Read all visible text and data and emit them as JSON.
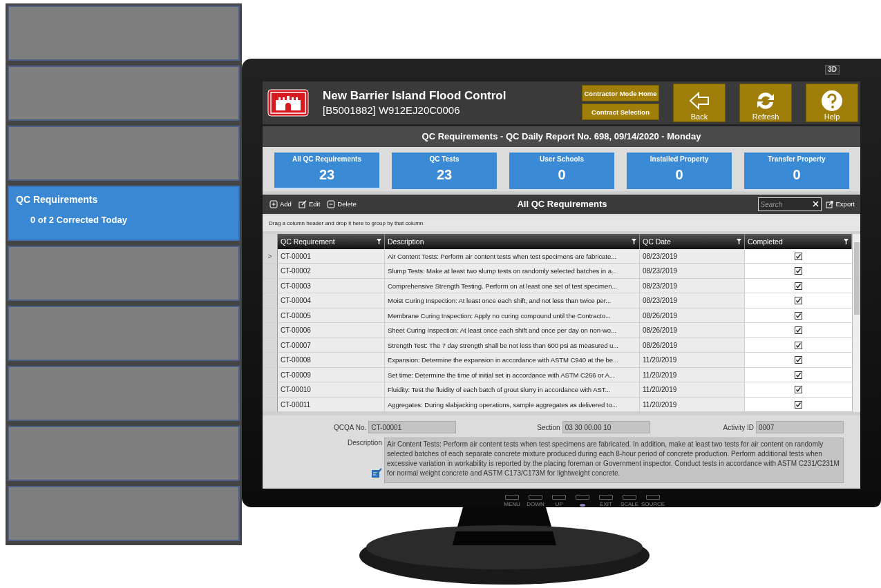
{
  "sidebar": {
    "items": [
      {
        "selected": false
      },
      {
        "selected": false
      },
      {
        "selected": false
      },
      {
        "title": "QC Requirements",
        "subtitle": "0 of 2 Corrected Today",
        "selected": true
      },
      {
        "selected": false
      },
      {
        "selected": false
      },
      {
        "selected": false
      },
      {
        "selected": false
      },
      {
        "selected": false
      }
    ]
  },
  "monitor": {
    "badge": "3D",
    "controls": [
      {
        "kind": "key",
        "label": "MENU"
      },
      {
        "kind": "key",
        "label": "DOWN"
      },
      {
        "kind": "key",
        "label": "UP"
      },
      {
        "kind": "power"
      },
      {
        "kind": "key",
        "label": "EXIT"
      },
      {
        "kind": "key",
        "label": "SCALE"
      },
      {
        "kind": "key",
        "label": "SOURCE"
      }
    ]
  },
  "header": {
    "title": "New Barrier Island Flood Control",
    "subtitle": "[B5001882] W912EJ20C0006",
    "nav_buttons": [
      "Contractor Mode Home",
      "Contract Selection"
    ],
    "icon_buttons": [
      {
        "kind": "back",
        "label": "Back"
      },
      {
        "kind": "refresh",
        "label": "Refresh"
      },
      {
        "kind": "help",
        "label": "Help"
      }
    ]
  },
  "report_title": "QC Requirements - QC Daily Report No. 698, 09/14/2020 - Monday",
  "tiles": [
    {
      "label": "All QC Requirements",
      "count": "23",
      "selected": true
    },
    {
      "label": "QC Tests",
      "count": "23",
      "selected": false
    },
    {
      "label": "User Schools",
      "count": "0",
      "selected": false
    },
    {
      "label": "Installed Property",
      "count": "0",
      "selected": false
    },
    {
      "label": "Transfer Property",
      "count": "0",
      "selected": false
    }
  ],
  "toolbar": {
    "actions": [
      {
        "kind": "add",
        "label": "Add"
      },
      {
        "kind": "edit",
        "label": "Edit"
      },
      {
        "kind": "delete",
        "label": "Delete"
      }
    ],
    "title": "All QC Requirements",
    "search": {
      "placeholder": "Search"
    },
    "export": "Export"
  },
  "group_hint": "Drag a column header and drop it here to group by that column",
  "table": {
    "current_marker": ">",
    "columns": [
      "QC Requirement",
      "Description",
      "QC Date",
      "Completed"
    ],
    "rows": [
      {
        "id": "CT-00001",
        "description": "Air Content Tests: Perform air content tests when test specimens are fabricate...",
        "qc_date": "08/23/2019",
        "completed": true,
        "selected": true
      },
      {
        "id": "CT-00002",
        "description": "Slump Tests: Make at least two slump tests on randomly selected batches in a...",
        "qc_date": "08/23/2019",
        "completed": true,
        "selected": false
      },
      {
        "id": "CT-00003",
        "description": "Comprehensive Strength Testing. Perform on at least one set of test specimen...",
        "qc_date": "08/23/2019",
        "completed": true,
        "selected": false
      },
      {
        "id": "CT-00004",
        "description": "Moist Curing Inspection: At least once each shift, and not less than twice per...",
        "qc_date": "08/23/2019",
        "completed": true,
        "selected": false
      },
      {
        "id": "CT-00005",
        "description": "Membrane Curing Inspection: Apply no curing compound until the Contracto...",
        "qc_date": "08/26/2019",
        "completed": true,
        "selected": false
      },
      {
        "id": "CT-00006",
        "description": "Sheet Curing Inspection: At least once each shift and once per day on non-wo...",
        "qc_date": "08/26/2019",
        "completed": true,
        "selected": false
      },
      {
        "id": "CT-00007",
        "description": "Strength Test: The 7 day strength shall be not less than 600 psi as measured u...",
        "qc_date": "08/26/2019",
        "completed": true,
        "selected": false
      },
      {
        "id": "CT-00008",
        "description": "Expansion: Determine the expansion in accordance with ASTM C940 at the be...",
        "qc_date": "11/20/2019",
        "completed": true,
        "selected": false
      },
      {
        "id": "CT-00009",
        "description": "Set time: Determine the time of initial set in accordance with ASTM C266 or A...",
        "qc_date": "11/20/2019",
        "completed": true,
        "selected": false
      },
      {
        "id": "CT-00010",
        "description": "Fluidity: Test the fluidity of each batch of grout slurry in accordance with AST...",
        "qc_date": "11/20/2019",
        "completed": true,
        "selected": false
      },
      {
        "id": "CT-00011",
        "description": "Aggregates: During slabjacking operations, sample aggregates as delivered to...",
        "qc_date": "11/20/2019",
        "completed": true,
        "selected": false
      }
    ]
  },
  "details": {
    "fields": [
      {
        "label": "QCQA No.",
        "value": "CT-00001"
      },
      {
        "label": "Section",
        "value": "03 30 00.00 10"
      },
      {
        "label": "Activity ID",
        "value": "0007"
      }
    ],
    "description_label": "Description",
    "description": "Air Content Tests: Perform air content tests when test specimens are fabricated. In addition, make at least two tests for air content on randomly selected batches of each separate concrete mixture produced during each 8-hour period of concrete production. Perform additional tests when excessive variation in workability is reported by the placing foreman or Government inspector. Conduct tests in accordance with ASTM C231/C231M for normal weight concrete and ASTM C173/C173M for lightweight concrete."
  }
}
